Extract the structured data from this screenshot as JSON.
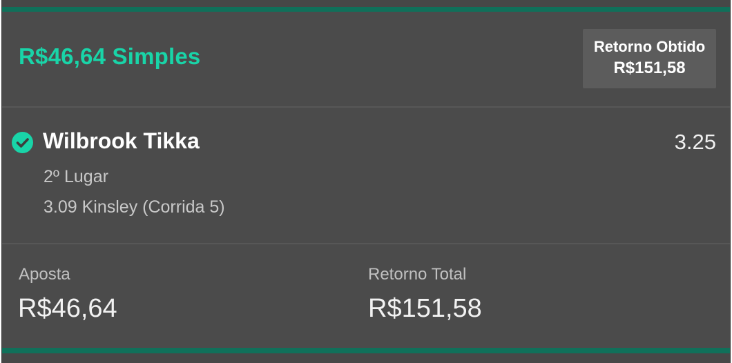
{
  "header": {
    "bet_title": "R$46,64 Simples",
    "return_label": "Retorno Obtido",
    "return_amount": "R$151,58"
  },
  "selection": {
    "status_icon": "check-circle-icon",
    "name": "Wilbrook Tikka",
    "odds": "3.25",
    "market": "2º Lugar",
    "event": "3.09 Kinsley (Corrida 5)"
  },
  "totals": {
    "stake_label": "Aposta",
    "stake_value": "R$46,64",
    "total_return_label": "Retorno Total",
    "total_return_value": "R$151,58"
  },
  "colors": {
    "accent": "#19d4a8",
    "bar": "#10705a",
    "background": "#4b4b4b"
  }
}
